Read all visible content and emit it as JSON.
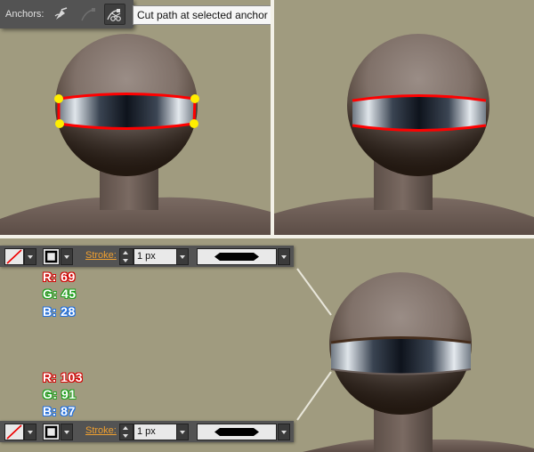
{
  "anchors_toolbar": {
    "label": "Anchors:",
    "tools": [
      {
        "name": "convert-anchor-icon",
        "selected": false
      },
      {
        "name": "remove-anchor-icon",
        "selected": false
      },
      {
        "name": "cut-path-icon",
        "selected": true
      }
    ],
    "tooltip": "Cut path at selected anchor points"
  },
  "stroke_toolbar_top": {
    "stroke_label": "Stroke:",
    "stroke_weight": "1 px"
  },
  "stroke_toolbar_bottom": {
    "stroke_label": "Stroke:",
    "stroke_weight": "1 px"
  },
  "color_top": {
    "r": "R: 69",
    "g": "G: 45",
    "b": "B: 28"
  },
  "color_bottom": {
    "r": "R: 103",
    "g": "G: 91",
    "b": "B: 87"
  },
  "colors": {
    "background": "#a09b7f",
    "head": "#8c7f78",
    "body": "#6e5f58",
    "visor_dark": "#10151f",
    "visor_light": "#c8d0d8",
    "path_red": "#ff0000",
    "anchor_yellow": "#ffee00",
    "brown_stroke": "#452d1c",
    "grey_fill": "#675b57"
  }
}
